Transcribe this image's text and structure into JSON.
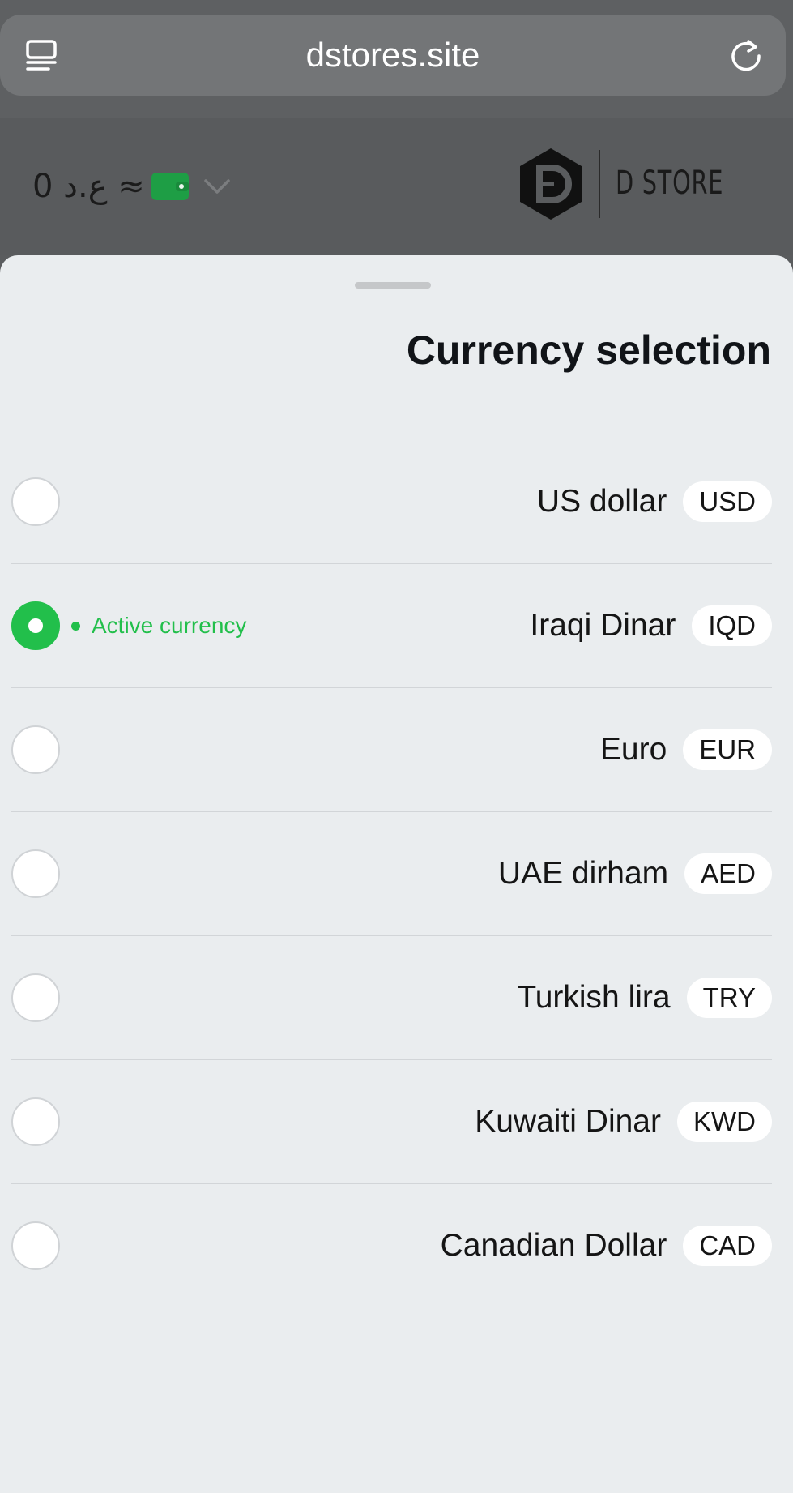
{
  "browser": {
    "url": "dstores.site"
  },
  "header": {
    "balance": "ع.د 0 ≈",
    "brand_name": "D STORE"
  },
  "sheet": {
    "title": "Currency selection",
    "active_label": "Active currency",
    "currencies": [
      {
        "name": "US dollar",
        "code": "USD",
        "selected": false
      },
      {
        "name": "Iraqi Dinar",
        "code": "IQD",
        "selected": true
      },
      {
        "name": "Euro",
        "code": "EUR",
        "selected": false
      },
      {
        "name": "UAE dirham",
        "code": "AED",
        "selected": false
      },
      {
        "name": "Turkish lira",
        "code": "TRY",
        "selected": false
      },
      {
        "name": "Kuwaiti Dinar",
        "code": "KWD",
        "selected": false
      },
      {
        "name": "Canadian Dollar",
        "code": "CAD",
        "selected": false
      }
    ]
  },
  "colors": {
    "accent": "#22bf4b",
    "wallet": "#1e9e45"
  }
}
